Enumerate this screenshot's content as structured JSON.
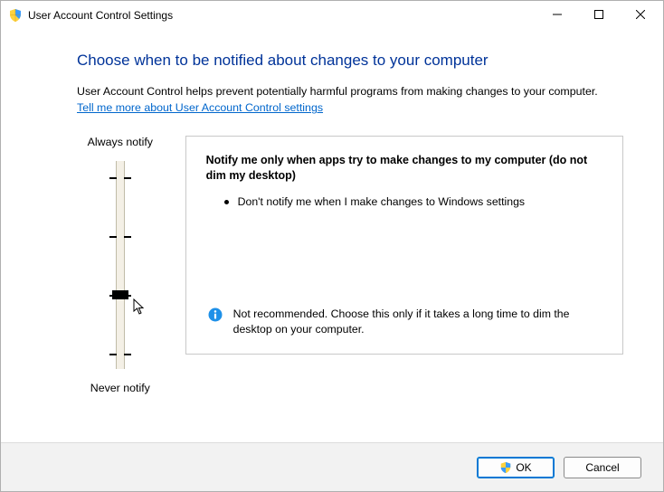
{
  "titlebar": {
    "title": "User Account Control Settings"
  },
  "content": {
    "heading": "Choose when to be notified about changes to your computer",
    "description": "User Account Control helps prevent potentially harmful programs from making changes to your computer.",
    "link_text": "Tell me more about User Account Control settings"
  },
  "slider": {
    "top_label": "Always notify",
    "bottom_label": "Never notify",
    "levels": 4,
    "selected_index": 2
  },
  "panel": {
    "title": "Notify me only when apps try to make changes to my computer (do not dim my desktop)",
    "bullets": [
      "Don't notify me when I make changes to Windows settings"
    ],
    "recommendation": "Not recommended. Choose this only if it takes a long time to dim the desktop on your computer."
  },
  "footer": {
    "ok_label": "OK",
    "cancel_label": "Cancel"
  }
}
